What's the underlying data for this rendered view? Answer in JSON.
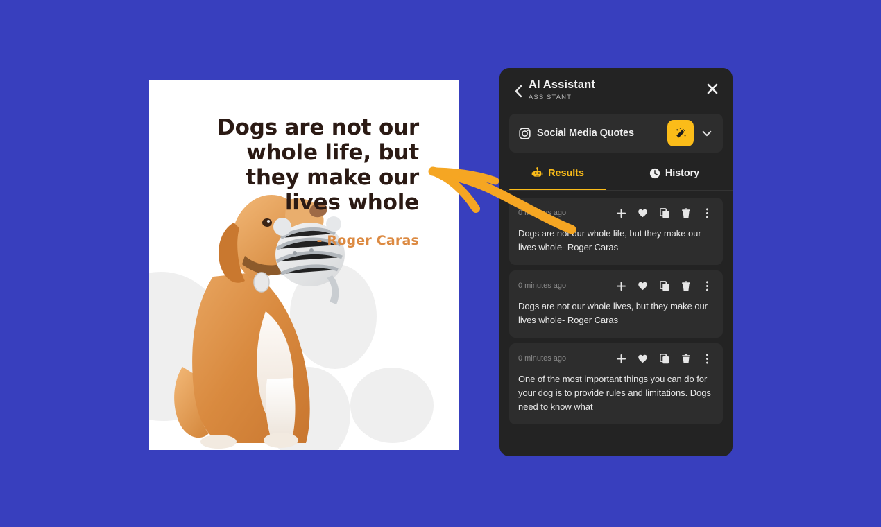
{
  "theme": {
    "page_background": "#383FBE",
    "panel_background": "#232323",
    "card_background": "#2D2D2D",
    "accent": "#FBBC19",
    "quote_author_color": "#DC8A42",
    "quote_text_color": "#2B1A14",
    "annotation_arrow_color": "#F5A623"
  },
  "quote_card": {
    "quote": "Dogs are not our whole life, but they make our lives whole",
    "author": "- Roger Caras",
    "image_alt": "dog-with-plush-toy-photo"
  },
  "panel": {
    "back_icon": "chevron-left-icon",
    "title": "AI Assistant",
    "subtitle": "ASSISTANT",
    "close_icon": "close-icon",
    "selector": {
      "icon": "instagram-icon",
      "label": "Social Media Quotes",
      "generate_icon": "magic-wand-icon",
      "chevron_icon": "chevron-down-icon"
    },
    "tabs": [
      {
        "label": "Results",
        "icon": "robot-icon",
        "active": true
      },
      {
        "label": "History",
        "icon": "clock-icon",
        "active": false
      }
    ],
    "card_actions": [
      {
        "name": "add-icon",
        "title": "Add"
      },
      {
        "name": "heart-icon",
        "title": "Favorite"
      },
      {
        "name": "copy-icon",
        "title": "Copy"
      },
      {
        "name": "trash-icon",
        "title": "Delete"
      },
      {
        "name": "more-vertical-icon",
        "title": "More"
      }
    ],
    "results": [
      {
        "time": "0 minutes ago",
        "text": "Dogs are not our whole life, but they make our lives whole- Roger Caras"
      },
      {
        "time": "0 minutes ago",
        "text": "Dogs are not our whole lives, but they make our lives whole- Roger Caras"
      },
      {
        "time": "0 minutes ago",
        "text": "One of the most important things you can do for your dog is to provide rules and limitations. Dogs need to know what"
      }
    ]
  }
}
